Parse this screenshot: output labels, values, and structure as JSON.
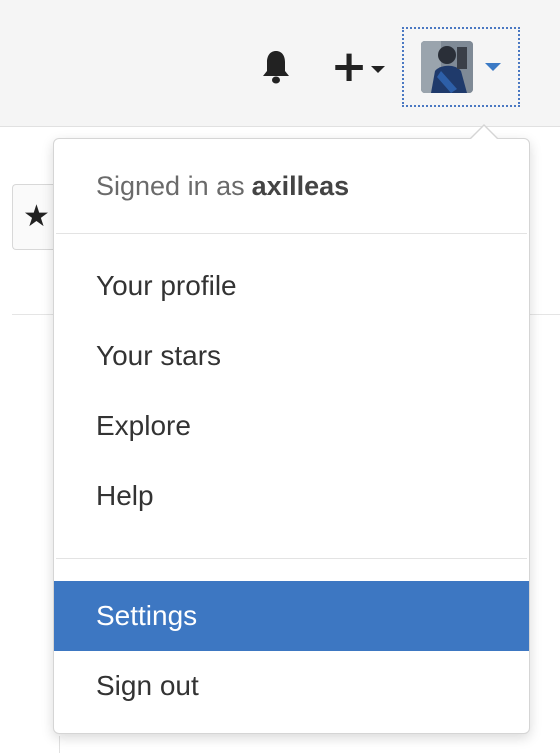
{
  "header": {
    "notifications_icon": "bell-icon",
    "create_icon": "plus-icon",
    "create_symbol": "+",
    "avatar_icon": "user-avatar"
  },
  "background": {
    "star_symbol": "★"
  },
  "dropdown": {
    "signed_in_prefix": "Signed in as",
    "username": "axilleas",
    "primary_items": [
      {
        "label": "Your profile"
      },
      {
        "label": "Your stars"
      },
      {
        "label": "Explore"
      },
      {
        "label": "Help"
      }
    ],
    "secondary_items": [
      {
        "label": "Settings",
        "active": true
      },
      {
        "label": "Sign out",
        "active": false
      }
    ]
  },
  "colors": {
    "accent": "#3d77c2",
    "caret_blue": "#3b7ac5",
    "header_bg": "#f5f5f5"
  }
}
